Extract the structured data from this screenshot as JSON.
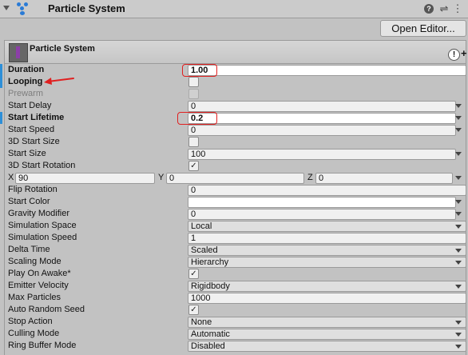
{
  "component": {
    "title": "Particle System",
    "help": "?",
    "settings_icon": "⚙",
    "sliders_icon": "⇌",
    "menu_icon": "⋮"
  },
  "open_editor_label": "Open Editor...",
  "module": {
    "title": "Particle System",
    "alert": "!",
    "plus": "+"
  },
  "rows": [
    {
      "label": "Duration",
      "value": "1.00"
    },
    {
      "label": "Looping"
    },
    {
      "label": "Prewarm"
    },
    {
      "label": "Start Delay",
      "value": "0"
    },
    {
      "label": "Start Lifetime",
      "value": "0.2"
    },
    {
      "label": "Start Speed",
      "value": "0"
    },
    {
      "label": "3D Start Size"
    },
    {
      "label": "Start Size",
      "value": "100"
    },
    {
      "label": "3D Start Rotation",
      "check": "✓"
    },
    {
      "x_label": "X",
      "x": "90",
      "y_label": "Y",
      "y": "0",
      "z_label": "Z",
      "z": "0"
    },
    {
      "label": "Flip Rotation",
      "value": "0"
    },
    {
      "label": "Start Color"
    },
    {
      "label": "Gravity Modifier",
      "value": "0"
    },
    {
      "label": "Simulation Space",
      "value": "Local"
    },
    {
      "label": "Simulation Speed",
      "value": "1"
    },
    {
      "label": "Delta Time",
      "value": "Scaled"
    },
    {
      "label": "Scaling Mode",
      "value": "Hierarchy"
    },
    {
      "label": "Play On Awake*",
      "check": "✓"
    },
    {
      "label": "Emitter Velocity",
      "value": "Rigidbody"
    },
    {
      "label": "Max Particles",
      "value": "1000"
    },
    {
      "label": "Auto Random Seed",
      "check": "✓"
    },
    {
      "label": "Stop Action",
      "value": "None"
    },
    {
      "label": "Culling Mode",
      "value": "Automatic"
    },
    {
      "label": "Ring Buffer Mode",
      "value": "Disabled"
    }
  ],
  "colors": {
    "highlight": "#e02020",
    "accent": "#2e8fd8",
    "particle_icon": "#8c3fa8"
  }
}
